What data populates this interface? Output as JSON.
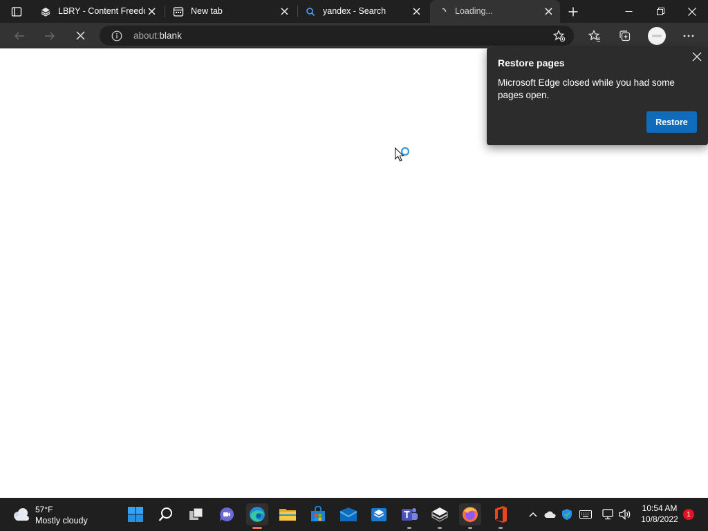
{
  "colors": {
    "tabstrip_bg": "#202020",
    "toolbar_bg": "#333333",
    "accent": "#0f6cbd",
    "taskbar_bg": "#1f1f1f",
    "popup_bg": "#2c2c2c"
  },
  "tabs": [
    {
      "title": "LBRY - Content Freedom",
      "icon": "lbry-cube-icon",
      "active": false
    },
    {
      "title": "New tab",
      "icon": "new-tab-page-icon",
      "active": false
    },
    {
      "title": "yandex - Search",
      "icon": "search-icon",
      "active": false
    },
    {
      "title": "Loading...",
      "icon": "loading-spinner-icon",
      "active": true
    }
  ],
  "address_bar": {
    "url_prefix": "about:",
    "url_host": "blank",
    "info_icon": "info-icon"
  },
  "toolbar_icons": [
    "back-icon",
    "forward-icon",
    "stop-icon",
    "add-favorite-icon",
    "favorites-icon",
    "collections-icon",
    "profile-avatar",
    "more-icon"
  ],
  "restore_popup": {
    "title": "Restore pages",
    "message": "Microsoft Edge closed while you had some pages open.",
    "button": "Restore"
  },
  "taskbar": {
    "weather": {
      "temperature": "57°F",
      "condition": "Mostly cloudy"
    },
    "apps": [
      "start",
      "search",
      "task-view",
      "chat",
      "edge",
      "file-explorer",
      "microsoft-store",
      "mail",
      "app-store-box",
      "teams",
      "lbry",
      "firefox",
      "office"
    ],
    "clock": {
      "time": "10:54 AM",
      "date": "10/8/2022"
    },
    "notifications": "1"
  }
}
